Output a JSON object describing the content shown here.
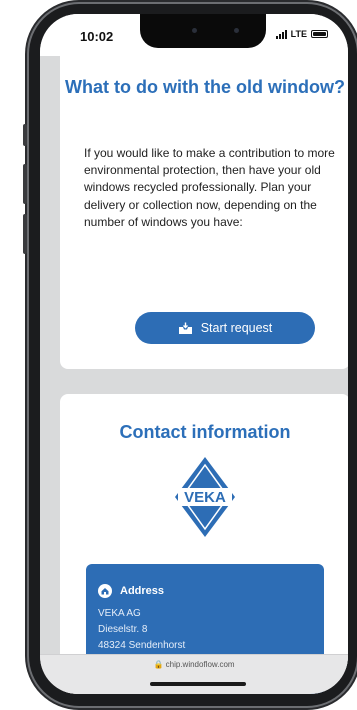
{
  "status_bar": {
    "time": "10:02",
    "network": "LTE"
  },
  "recycle_card": {
    "title": "What to do with the old window?",
    "body": "If you would like to make a contribution to more environmental protection, then have your old windows recycled professionally. Plan your delivery or collection now, depending on the number of windows you have:",
    "button_label": "Start request",
    "button_icon": "inbox-icon"
  },
  "contact_card": {
    "title": "Contact information",
    "logo_text": "VEKA",
    "address": {
      "heading": "Address",
      "icon": "home-icon",
      "lines": [
        "VEKA AG",
        "Dieselstr. 8",
        "48324 Sendenhorst"
      ]
    }
  },
  "browser": {
    "url": "chip.windoflow.com"
  },
  "colors": {
    "brand_blue": "#2d6db5",
    "title_blue": "#2c6fb9"
  }
}
